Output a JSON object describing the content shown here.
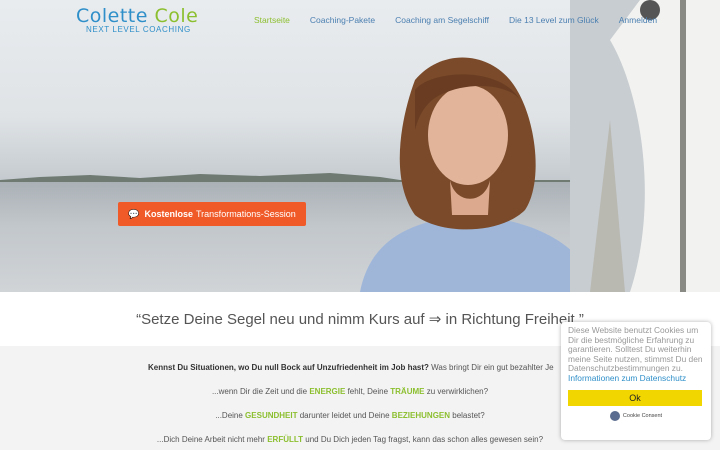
{
  "logo": {
    "first": "Colette",
    "second": "Cole",
    "tag_a": "NEXT LEVEL",
    "tag_b": "COACHING"
  },
  "nav": {
    "items": [
      {
        "label": "Startseite",
        "active": true
      },
      {
        "label": "Coaching-Pakete"
      },
      {
        "label": "Coaching am Segelschiff"
      },
      {
        "label": "Die 13 Level zum Glück"
      },
      {
        "label": "Anmelden"
      }
    ]
  },
  "cta": {
    "icon": "chat-bubbles-icon",
    "bold": "Kostenlose",
    "rest": "Transformations-Session"
  },
  "quote": "“Setze Deine Segel neu und nimm Kurs auf ⇒ in Richtung Freiheit.”",
  "content": {
    "line1_bold": "Kennst Du Situationen, wo Du null Bock auf Unzufriedenheit im Job hast?",
    "line1_rest": " Was bringt Dir ein gut bezahlter Je",
    "line2_a": "...wenn Dir die Zeit und die ",
    "line2_hl": "ENERGIE",
    "line2_b": " fehlt, Deine ",
    "line2_hl2": "TRÄUME",
    "line2_c": " zu verwirklichen?",
    "line3_a": "...Deine ",
    "line3_hl": "GESUNDHEIT",
    "line3_b": " darunter leidet und Deine ",
    "line3_hl2": "BEZIEHUNGEN",
    "line3_c": " belastet?",
    "line4_a": "...Dich Deine Arbeit nicht mehr ",
    "line4_hl": "ERFÜLLT",
    "line4_b": " und Du Dich jeden Tag fragst, kann das schon alles gewesen sein?"
  },
  "cookie": {
    "message": "Diese Website benutzt Cookies um Dir die bestmögliche Erfahrung zu garantieren. Solltest Du weiterhin meine Seite nutzen, stimmst Du den Datenschutzbestimmungen zu.",
    "link": "Informationen zum Datenschutz",
    "ok": "Ok",
    "brand": "Cookie Consent"
  },
  "colors": {
    "accent_green": "#8cbf2f",
    "accent_blue": "#2f8fc9",
    "cta": "#f05a28",
    "cookie_button": "#f1d600"
  }
}
